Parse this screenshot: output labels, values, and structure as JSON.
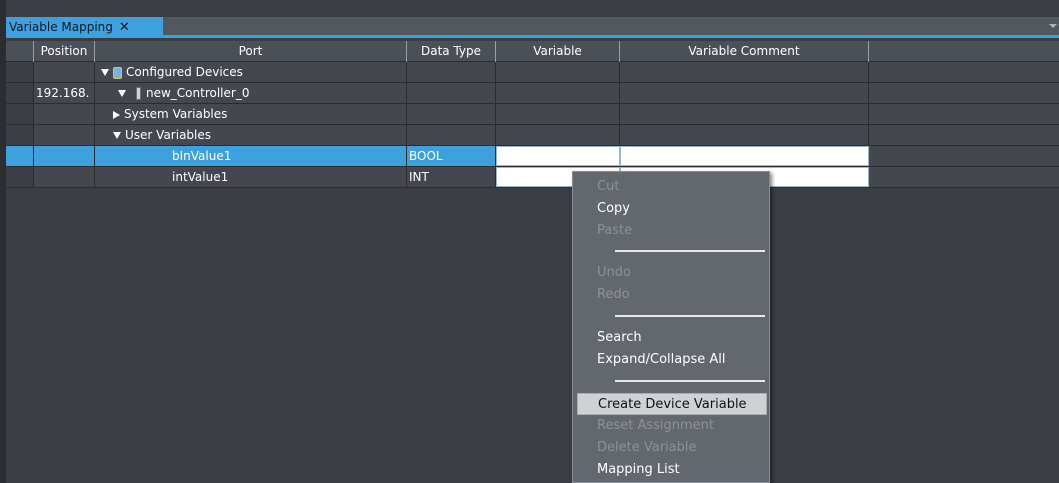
{
  "tab": {
    "label": "Variable Mapping",
    "close": "✕"
  },
  "columns": [
    "Position",
    "Port",
    "Data Type",
    "Variable",
    "Variable Comment"
  ],
  "rows": [
    {
      "position": "",
      "port": "Configured Devices",
      "data_type": ""
    },
    {
      "position": "192.168.",
      "port": "new_Controller_0",
      "data_type": ""
    },
    {
      "position": "",
      "port": "System Variables",
      "data_type": ""
    },
    {
      "position": "",
      "port": "User Variables",
      "data_type": ""
    },
    {
      "position": "",
      "port": "bInValue1",
      "data_type": "BOOL"
    },
    {
      "position": "",
      "port": "intValue1",
      "data_type": "INT"
    }
  ],
  "context_menu": {
    "cut": "Cut",
    "copy": "Copy",
    "paste": "Paste",
    "undo": "Undo",
    "redo": "Redo",
    "search": "Search",
    "expand_collapse": "Expand/Collapse All",
    "create_device_variable": "Create Device Variable",
    "reset_assignment": "Reset Assignment",
    "delete_variable": "Delete Variable",
    "mapping_list": "Mapping List"
  },
  "colors": {
    "accent": "#3ea0dc",
    "menu_bg": "#63676e",
    "grid_bg": "#44474d"
  }
}
